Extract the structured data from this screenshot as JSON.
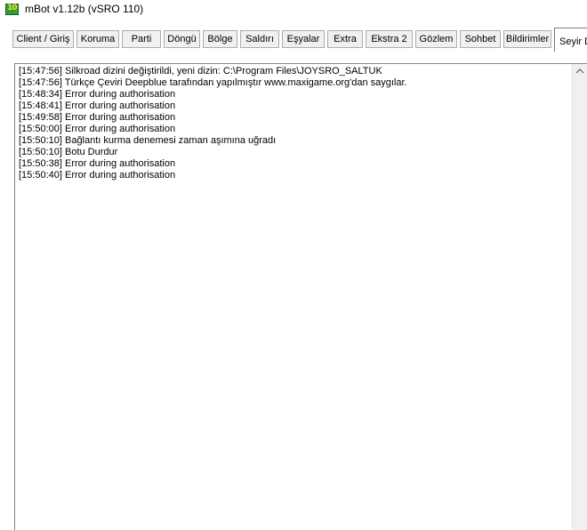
{
  "window": {
    "title": "mBot v1.12b (vSRO 110)",
    "icon": "mbot-app-icon",
    "icon_text": "10"
  },
  "tabs": [
    {
      "label": "Client / Giriş"
    },
    {
      "label": "Koruma"
    },
    {
      "label": "Parti"
    },
    {
      "label": "Döngü"
    },
    {
      "label": "Bölge"
    },
    {
      "label": "Saldırı"
    },
    {
      "label": "Eşyalar"
    },
    {
      "label": "Extra"
    },
    {
      "label": "Ekstra 2"
    },
    {
      "label": "Gözlem"
    },
    {
      "label": "Sohbet"
    },
    {
      "label": "Bildirimler"
    },
    {
      "label": "Seyir D",
      "active": true
    }
  ],
  "log": [
    "[15:47:56] Silkroad dizini değiştirildi, yeni dizin: C:\\Program Files\\JOYSRO_SALTUK",
    "[15:47:56] Türkçe Çeviri Deepblue tarafından yapılmıştır www.maxigame.org'dan saygılar.",
    "[15:48:34] Error during authorisation",
    "[15:48:41] Error during authorisation",
    "[15:49:58] Error during authorisation",
    "[15:50:00] Error during authorisation",
    "[15:50:10] Bağlantı kurma denemesi zaman aşımına uğradı",
    "[15:50:10] Botu Durdur",
    "[15:50:38] Error during authorisation",
    "[15:50:40] Error during authorisation"
  ],
  "scrollbar": {
    "up_arrow_icon": "scroll-up-icon"
  }
}
